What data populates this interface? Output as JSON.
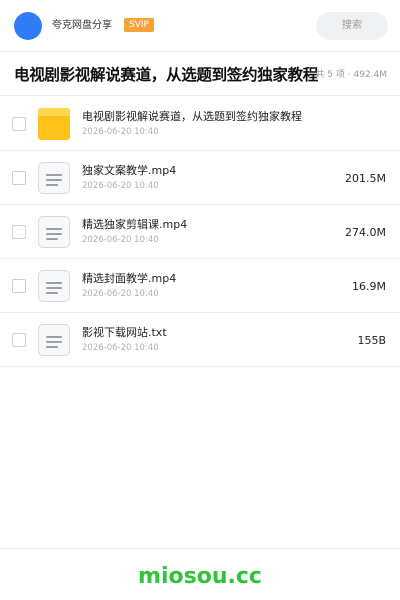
{
  "header": {
    "app_name": "夸克网盘分享",
    "badge": "SVIP",
    "search_label": "搜索"
  },
  "share": {
    "title": "电视剧影视解说赛道，从选题到签约独家教程",
    "summary": "共 5 项 · 492.4M"
  },
  "files": [
    {
      "type": "folder",
      "name": "电视剧影视解说赛道，从选题到签约独家教程",
      "date": "2026-06-20 10:40",
      "size": ""
    },
    {
      "type": "file",
      "name": "独家文案教学.mp4",
      "date": "2026-06-20 10:40",
      "size": "201.5M"
    },
    {
      "type": "file",
      "name": "精选独家剪辑课.mp4",
      "date": "2026-06-20 10:40",
      "size": "274.0M"
    },
    {
      "type": "file",
      "name": "精选封面教学.mp4",
      "date": "2026-06-20 10:40",
      "size": "16.9M"
    },
    {
      "type": "file",
      "name": "影视下载网站.txt",
      "date": "2026-06-20 10:40",
      "size": "155B"
    }
  ],
  "footer": {
    "brand": "miosou.cc"
  },
  "colors": {
    "avatar": "#2f7cf6",
    "badge": "#f7a13a",
    "folder": "#ffc21a",
    "brand": "#33c23b"
  },
  "icons": {
    "folder": "folder-icon",
    "file": "file-icon"
  }
}
